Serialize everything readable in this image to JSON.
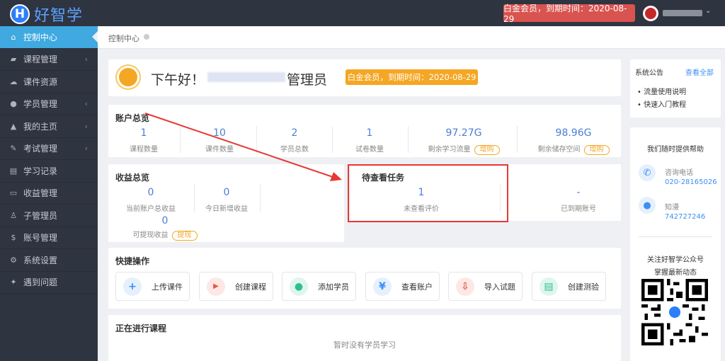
{
  "brand": {
    "badge": "H",
    "name": "好智学"
  },
  "header": {
    "vip_status": "白金会员，到期时间：2020-08-29",
    "dropdown_arrow": "⌄"
  },
  "sidebar": {
    "items": [
      {
        "label": "控制中心",
        "icon": "home-icon"
      },
      {
        "label": "课程管理",
        "icon": "book-icon"
      },
      {
        "label": "课件资源",
        "icon": "cloud-icon"
      },
      {
        "label": "学员管理",
        "icon": "users-icon"
      },
      {
        "label": "我的主页",
        "icon": "graduation-cap-icon"
      },
      {
        "label": "考试管理",
        "icon": "exam-icon"
      },
      {
        "label": "学习记录",
        "icon": "record-icon"
      },
      {
        "label": "收益管理",
        "icon": "card-icon"
      },
      {
        "label": "子管理员",
        "icon": "user-icon"
      },
      {
        "label": "账号管理",
        "icon": "dollar-icon"
      },
      {
        "label": "系统设置",
        "icon": "gear-icon"
      },
      {
        "label": "遇到问题",
        "icon": "wrench-icon"
      }
    ]
  },
  "breadcrumb": "控制中心",
  "greeting": {
    "hello": "下午好！",
    "role": "管理员",
    "vip": "白金会员，到期时间：2020-08-29"
  },
  "account": {
    "title": "账户总览",
    "stats": [
      {
        "value": "1",
        "label": "课程数量"
      },
      {
        "value": "10",
        "label": "课件数量"
      },
      {
        "value": "2",
        "label": "学员总数"
      },
      {
        "value": "1",
        "label": "试卷数量"
      },
      {
        "value": "97.27G",
        "label": "剩余学习流量",
        "action": "增购"
      },
      {
        "value": "98.96G",
        "label": "剩余储存空间",
        "action": "增购"
      }
    ]
  },
  "income": {
    "title": "收益总览",
    "stats": [
      {
        "value": "0",
        "label": "当前账户总收益"
      },
      {
        "value": "0",
        "label": "今日新增收益"
      },
      {
        "value": "0",
        "label": "可提现收益",
        "action": "提现"
      }
    ]
  },
  "tasks": {
    "title": "待查看任务",
    "stats": [
      {
        "value": "1",
        "label": "未查看评价"
      },
      {
        "value": "-",
        "label": "已到期账号"
      }
    ]
  },
  "quick": {
    "title": "快捷操作",
    "buttons": [
      {
        "label": "上传课件",
        "icon": "plus-icon",
        "glyph": "+",
        "color": "#3d8ff2",
        "bg": "#e6f0fd"
      },
      {
        "label": "创建课程",
        "icon": "video-icon",
        "glyph": "▶",
        "color": "#e05a47",
        "bg": "#fde8e5"
      },
      {
        "label": "添加学员",
        "icon": "user-add-icon",
        "glyph": "●",
        "color": "#2fbf8f",
        "bg": "#dff6ee"
      },
      {
        "label": "查看账户",
        "icon": "yen-icon",
        "glyph": "¥",
        "color": "#3d8ff2",
        "bg": "#e6f0fd"
      },
      {
        "label": "导入试题",
        "icon": "download-icon",
        "glyph": "⇩",
        "color": "#e05a47",
        "bg": "#fde8e5"
      },
      {
        "label": "创建测验",
        "icon": "document-icon",
        "glyph": "▤",
        "color": "#2fbf8f",
        "bg": "#dff6ee"
      }
    ]
  },
  "ongoing": {
    "title": "正在进行课程",
    "empty": "暂时没有学员学习"
  },
  "notice": {
    "title": "系统公告",
    "view_all": "查看全部",
    "items": [
      "流量使用说明",
      "快速入门教程"
    ]
  },
  "help": {
    "title": "我们随时提供帮助",
    "phone_label": "咨询电话",
    "phone": "020-28165026",
    "qq_label": "知漫",
    "qq": "742727246",
    "follow": "关注好智学公众号",
    "follow_sub": "掌握最新动态"
  },
  "colors": {
    "sidebar_bg": "#2f3441",
    "active": "#3fa9e0",
    "accent_blue": "#4a7fd8",
    "orange": "#f5a623",
    "red": "#d9534f"
  }
}
